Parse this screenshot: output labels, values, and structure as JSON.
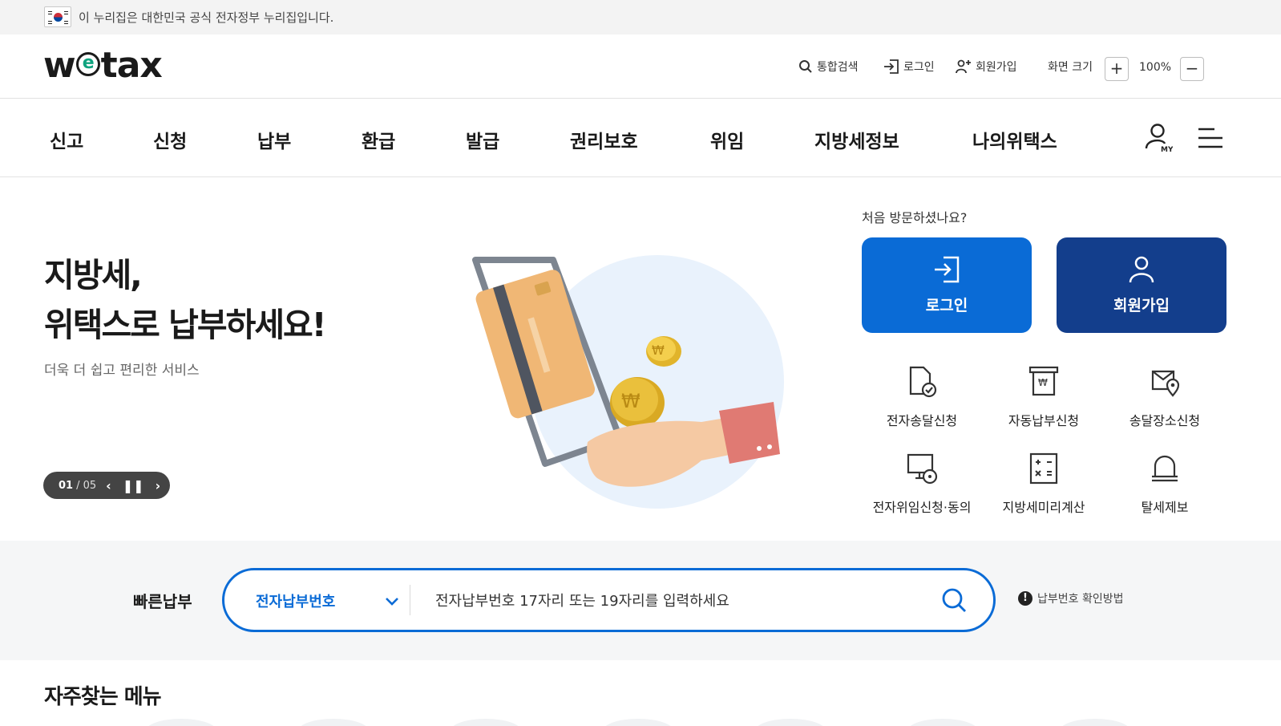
{
  "gov_banner": {
    "text": "이 누리집은 대한민국 공식 전자정부 누리집입니다."
  },
  "header": {
    "logo": {
      "w": "w",
      "e": "e",
      "tax": "tax"
    },
    "util": {
      "search": "통합검색",
      "login": "로그인",
      "signup": "회원가입",
      "zoom_label": "화면 크기",
      "zoom_in": "+",
      "zoom_value": "100%",
      "zoom_out": "−"
    }
  },
  "nav": {
    "items": [
      "신고",
      "신청",
      "납부",
      "환급",
      "발급",
      "권리보호",
      "위임",
      "지방세정보",
      "나의위택스"
    ],
    "my_icon": "user-my-icon",
    "menu_icon": "hamburger-menu-icon"
  },
  "hero": {
    "headline_line1": "지방세,",
    "headline_line2": "위택스로 납부하세요!",
    "subtitle": "더욱 더 쉽고 편리한 서비스",
    "slider": {
      "current": "01",
      "total": "/ 05"
    }
  },
  "visitor": {
    "question": "처음 방문하셨나요?",
    "login_button": "로그인",
    "signup_button": "회원가입",
    "quick_icons": [
      {
        "label": "전자송달신청",
        "icon": "document-check-icon"
      },
      {
        "label": "자동납부신청",
        "icon": "auto-pay-icon"
      },
      {
        "label": "송달장소신청",
        "icon": "location-envelope-icon"
      },
      {
        "label": "전자위임신청·동의",
        "icon": "monitor-lock-icon"
      },
      {
        "label": "지방세미리계산",
        "icon": "calculator-icon"
      },
      {
        "label": "탈세제보",
        "icon": "alarm-bell-icon"
      }
    ]
  },
  "quick_pay": {
    "label": "빠른납부",
    "select_value": "전자납부번호",
    "placeholder": "전자납부번호 17자리 또는 19자리를 입력하세요",
    "help_text": "납부번호 확인방법"
  },
  "frequent_menu": {
    "title": "자주찾는 메뉴"
  },
  "colors": {
    "primary_blue": "#0a6bd6",
    "navy": "#133e8c",
    "dark": "#1a1a1a",
    "bar_gray": "#f5f6f7"
  }
}
